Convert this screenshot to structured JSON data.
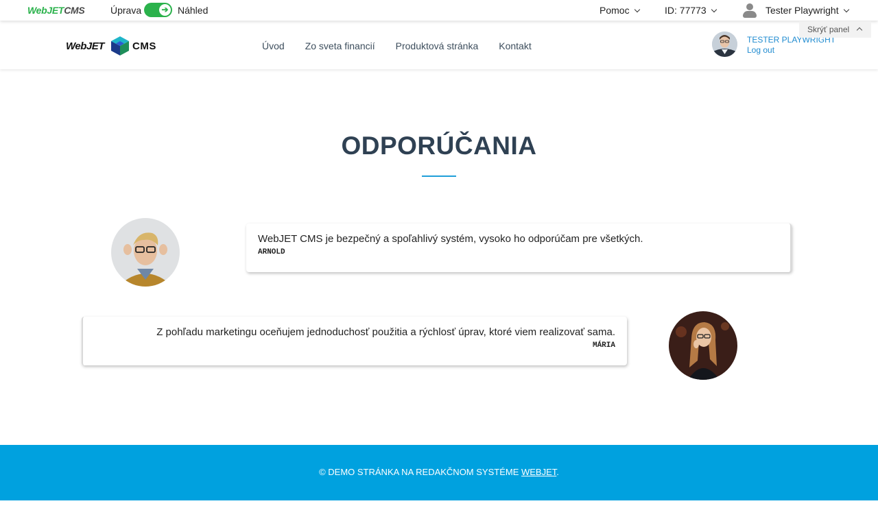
{
  "admin_bar": {
    "logo_green": "Web",
    "logo_mid": "JET",
    "logo_dark": "CMS",
    "mode_label": "Úprava",
    "preview_label": "Náhled",
    "help_label": "Pomoc",
    "id_label": "ID: 77773",
    "user_label": "Tester Playwright",
    "hide_panel_label": "Skrýť panel"
  },
  "header": {
    "logo_left": "WebJET",
    "logo_right": "CMS",
    "nav": [
      "Úvod",
      "Zo sveta financií",
      "Produktová stránka",
      "Kontakt"
    ],
    "profile_name": "TESTER PLAYWRIGHT",
    "logout_label": "Log out"
  },
  "main": {
    "title": "ODPORÚČANIA",
    "testimonials": [
      {
        "quote": "WebJET CMS je bezpečný a spoľahlivý systém, vysoko ho odporúčam pre všetkých.",
        "author": "ARNOLD"
      },
      {
        "quote": "Z pohľadu marketingu oceňujem jednoduchosť použitia a rýchlosť úprav, ktoré viem realizovať sama.",
        "author": "MÁRIA"
      }
    ]
  },
  "footer": {
    "text": "© DEMO STRÁNKA NA REDAKČNOM SYSTÉME ",
    "link": "WEBJET",
    "suffix": "."
  },
  "colors": {
    "accent_green": "#2bb24c",
    "link_blue": "#1f8bd0",
    "footer_blue": "#00a1df",
    "title_rule": "#1f9ed9"
  }
}
